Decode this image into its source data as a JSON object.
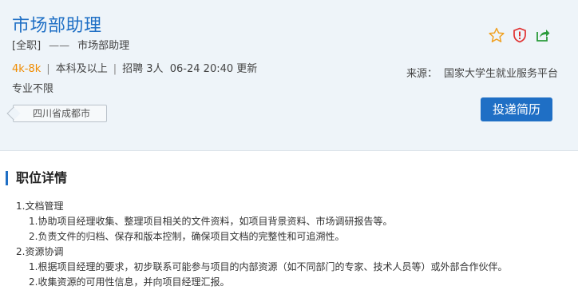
{
  "job": {
    "title": "市场部助理",
    "type": "[全职]",
    "dash": "——",
    "category": "市场部助理",
    "salary": "4k-8k",
    "separator": "|",
    "education": "本科及以上",
    "hiring": "招聘 3人",
    "updated": "06-24 20:40 更新",
    "major": "专业不限",
    "location": "四川省成都市"
  },
  "source": {
    "label": "来源：",
    "name": "国家大学生就业服务平台"
  },
  "actions": {
    "apply_label": "投递简历",
    "favorite_icon": "star-icon",
    "report_icon": "warning-shield-icon",
    "share_icon": "share-icon"
  },
  "detail": {
    "title": "职位详情",
    "lines": [
      "1.文档管理",
      "1.协助项目经理收集、整理项目相关的文件资料，如项目背景资料、市场调研报告等。",
      "2.负责文件的归档、保存和版本控制，确保项目文档的完整性和可追溯性。",
      "2.资源协调",
      "1.根据项目经理的要求，初步联系可能参与项目的内部资源（如不同部门的专家、技术人员等）或外部合作伙伴。",
      "2.收集资源的可用性信息，并向项目经理汇报。"
    ]
  },
  "colors": {
    "accent": "#1f6fc5",
    "salary": "#f08c00",
    "header_bg": "#eef4f9"
  }
}
